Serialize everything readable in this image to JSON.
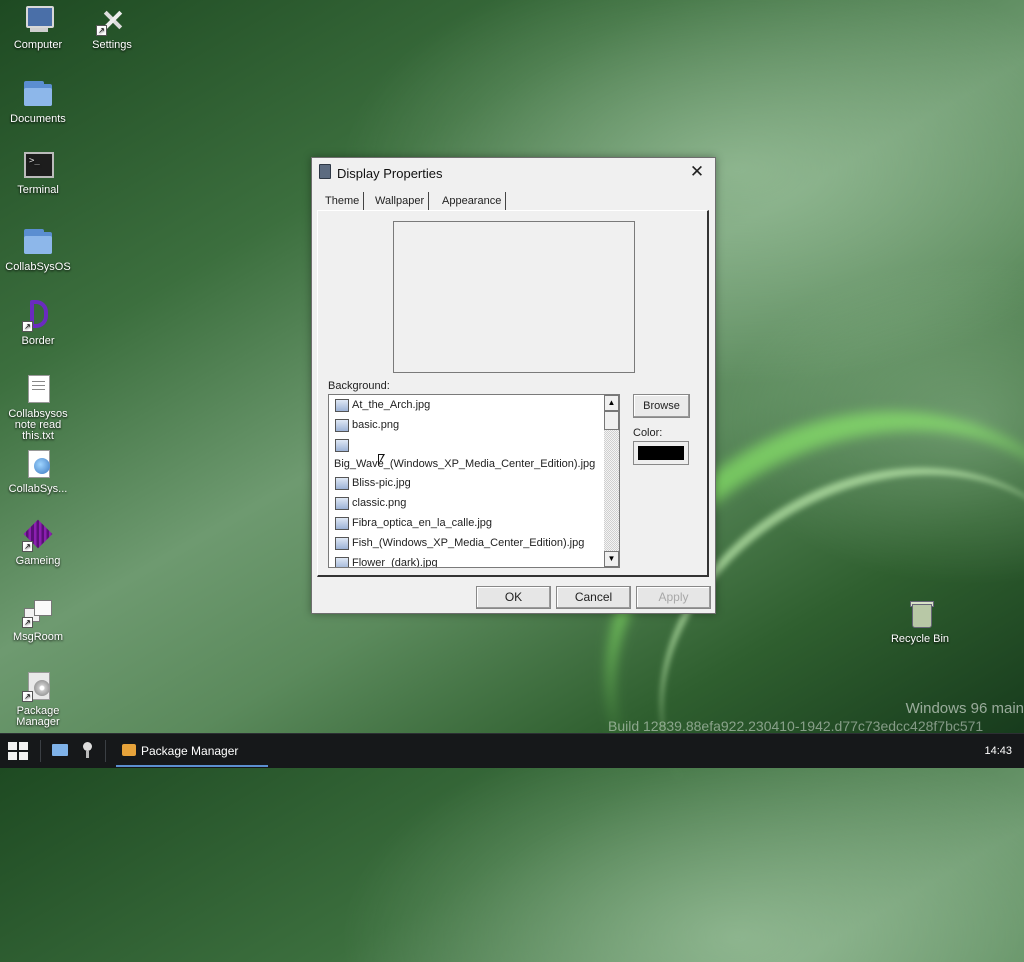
{
  "desktop": {
    "icons": [
      {
        "label": "Computer"
      },
      {
        "label": "Settings"
      },
      {
        "label": "Documents"
      },
      {
        "label": "Terminal"
      },
      {
        "label": "CollabSysOS"
      },
      {
        "label": "Border"
      },
      {
        "label": "Collabsysos note read this.txt"
      },
      {
        "label": "CollabSys..."
      },
      {
        "label": "Gameing"
      },
      {
        "label": "MsgRoom"
      },
      {
        "label": "Package Manager"
      },
      {
        "label": "Recycle Bin"
      }
    ],
    "watermark": {
      "line1": "Windows 96 main",
      "line2": "Build 12839.88efa922.230410-1942.d77c73edcc428f7bc571"
    }
  },
  "dialog": {
    "title": "Display Properties",
    "tabs": [
      {
        "label": "Theme"
      },
      {
        "label": "Wallpaper",
        "selected": true
      },
      {
        "label": "Appearance"
      }
    ],
    "background_label": "Background:",
    "files": [
      "At_the_Arch.jpg",
      "basic.png",
      "Big_Wave_(Windows_XP_Media_Center_Edition).jpg",
      "Bliss-pic.jpg",
      "classic.png",
      "Fibra_optica_en_la_calle.jpg",
      "Fish_(Windows_XP_Media_Center_Edition).jpg",
      "Flower_(dark).jpg"
    ],
    "browse_label": "Browse",
    "color_label": "Color:",
    "color_value": "#000000",
    "buttons": {
      "ok": "OK",
      "cancel": "Cancel",
      "apply": "Apply"
    }
  },
  "taskbar": {
    "tasks": [
      {
        "label": "Package Manager"
      }
    ],
    "clock": "14:43"
  },
  "colors": {
    "taskbar": "#16181a",
    "accent": "#5c8fd0",
    "dialog_bg": "#f0f0f0"
  }
}
